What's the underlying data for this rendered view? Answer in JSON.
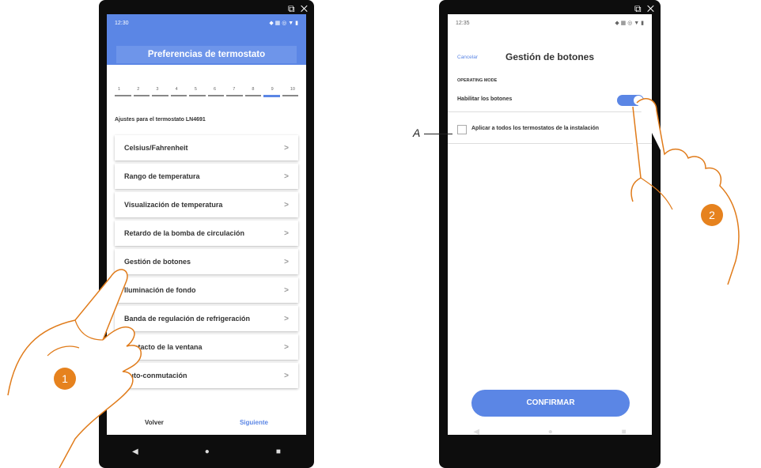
{
  "left_phone": {
    "status_time": "12:30",
    "header_title": "Preferencias de termostato",
    "steps": [
      "1",
      "2",
      "3",
      "4",
      "5",
      "6",
      "7",
      "8",
      "9",
      "10"
    ],
    "active_step": 9,
    "subtitle": "Ajustes para el termostato LN4691",
    "menu": [
      {
        "label": "Celsius/Fahrenheit"
      },
      {
        "label": "Rango de temperatura"
      },
      {
        "label": "Visualización de temperatura"
      },
      {
        "label": "Retardo de la bomba de circulación"
      },
      {
        "label": "Gestión de botones"
      },
      {
        "label": "Iluminación de fondo"
      },
      {
        "label": "Banda de regulación de refrigeración"
      },
      {
        "label": "Contacto de la ventana"
      },
      {
        "label": "Auto-conmutación"
      }
    ],
    "footer_back": "Volver",
    "footer_next": "Siguiente"
  },
  "right_phone": {
    "status_time": "12:35",
    "cancel_label": "Cancelar",
    "title": "Gestión de botones",
    "section": "OPERATING MODE",
    "toggle_label": "Habilitar los botones",
    "toggle_on": true,
    "checkbox_label": "Aplicar a todos los termostatos de la instalación",
    "checkbox_checked": false,
    "confirm_label": "CONFIRMAR"
  },
  "annotations": {
    "callout_a": "A",
    "badge_1": "1",
    "badge_2": "2"
  },
  "colors": {
    "accent": "#5b86e5",
    "badge": "#e6821e",
    "hand": "#e07b1a"
  }
}
